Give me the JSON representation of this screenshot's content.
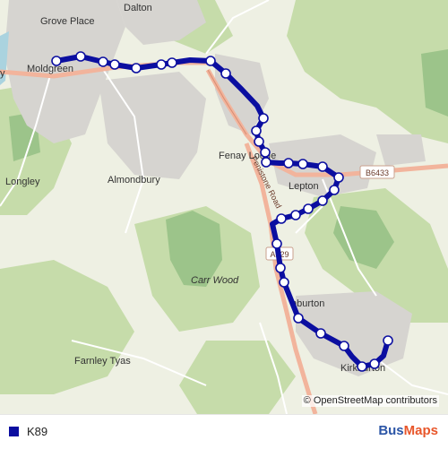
{
  "route": {
    "name": "K89",
    "color": "#0b0ea0"
  },
  "map": {
    "places": [
      "Grove Place",
      "Dalton",
      "Moldgreen",
      "Fenay Lodge",
      "Lepton",
      "Longley",
      "Almondbury",
      "Carr Wood",
      "Kirkburton",
      "Farnley Tyas",
      "y"
    ],
    "place_names": {
      "grove_place": "Grove Place",
      "dalton": "Dalton",
      "moldgreen": "Moldgreen",
      "fenay_lodge": "Fenay Lodge",
      "lepton": "Lepton",
      "longley": "Longley",
      "almondbury": "Almondbury",
      "carr_wood": "Carr Wood",
      "kirkburton": "Kirkburton",
      "farnley_tyas": "Farnley Tyas",
      "edge_y": "y",
      "shelburton": "hburton"
    },
    "roads": {
      "penistone": "Penistone Road",
      "a629": "A629",
      "b6433": "B6433"
    },
    "stop_count": 30
  },
  "attribution": "© OpenStreetMap contributors",
  "brand": {
    "part1": "Bus",
    "part2": "Maps"
  }
}
